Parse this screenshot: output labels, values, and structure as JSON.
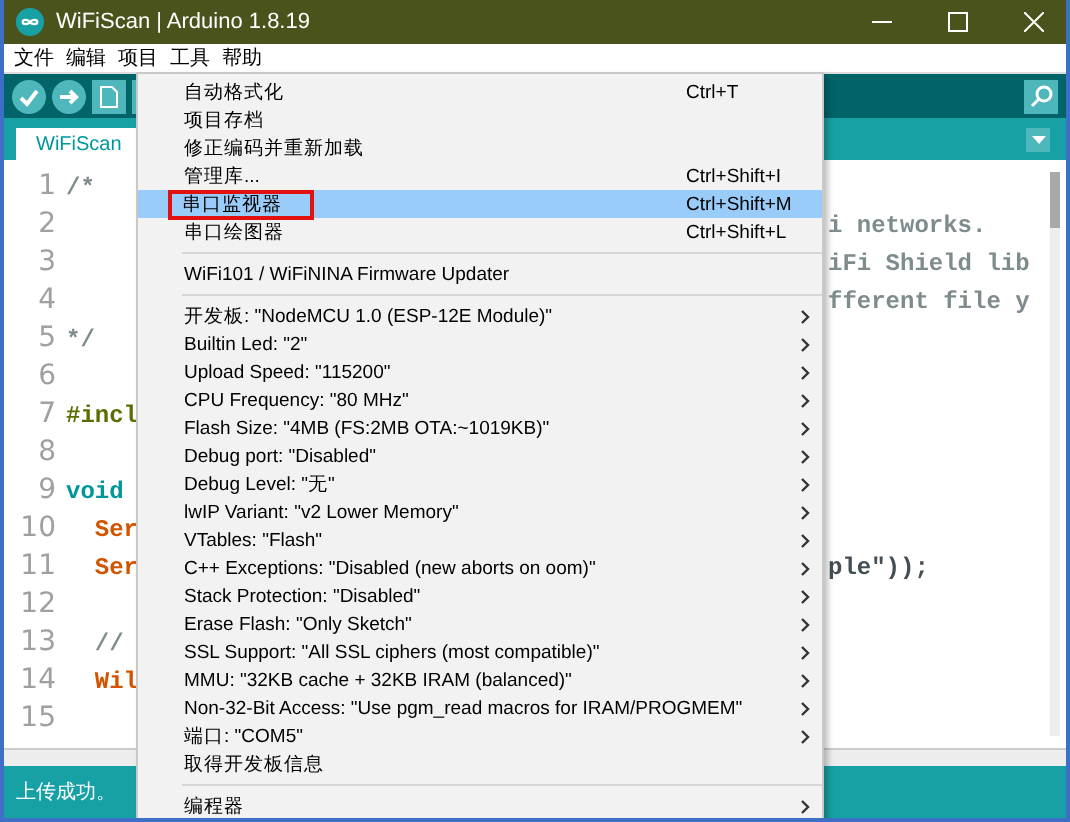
{
  "window": {
    "title": "WiFiScan | Arduino 1.8.19"
  },
  "menu_bar": [
    "文件",
    "编辑",
    "项目",
    "工具",
    "帮助"
  ],
  "tabs": [
    {
      "label": "WiFiScan",
      "selected": true
    }
  ],
  "editor": {
    "lines": [
      {
        "number": "1",
        "code": "/*",
        "kind": "comment"
      },
      {
        "number": "2",
        "tail": {
          "text": "i networks.",
          "kind": "comment"
        }
      },
      {
        "number": "3",
        "tail": {
          "text": "iFi Shield lib",
          "kind": "comment"
        }
      },
      {
        "number": "4",
        "tail": {
          "text": "fferent file y",
          "kind": "comment"
        }
      },
      {
        "number": "5",
        "code": "*/",
        "kind": "comment"
      },
      {
        "number": "6"
      },
      {
        "number": "7",
        "code": "#incl",
        "kind": "directive"
      },
      {
        "number": "8"
      },
      {
        "number": "9",
        "code": "void",
        "kind": "keyword"
      },
      {
        "number": "10",
        "code": "  Ser",
        "kind": "object"
      },
      {
        "number": "11",
        "code": "  Ser",
        "kind": "object",
        "tail": {
          "text": "ple\"));",
          "kind": "plain"
        }
      },
      {
        "number": "12"
      },
      {
        "number": "13",
        "code": "  //",
        "kind": "comment"
      },
      {
        "number": "14",
        "code": "  Wil",
        "kind": "object"
      },
      {
        "number": "15"
      }
    ]
  },
  "tools_menu": {
    "items": [
      {
        "kind": "item",
        "label": "自动格式化",
        "shortcut": "Ctrl+T",
        "selected": false,
        "outlined": false
      },
      {
        "kind": "item",
        "label": "项目存档",
        "selected": false,
        "outlined": false
      },
      {
        "kind": "item",
        "label": "修正编码并重新加载",
        "selected": false,
        "outlined": false
      },
      {
        "kind": "item",
        "label": "管理库...",
        "shortcut": "Ctrl+Shift+I",
        "selected": false,
        "outlined": false
      },
      {
        "kind": "item",
        "label": "串口监视器",
        "shortcut": "Ctrl+Shift+M",
        "selected": true,
        "outlined": true
      },
      {
        "kind": "item",
        "label": "串口绘图器",
        "shortcut": "Ctrl+Shift+L",
        "selected": false,
        "outlined": false
      },
      {
        "kind": "separator"
      },
      {
        "kind": "item",
        "label": "WiFi101 / WiFiNINA Firmware Updater",
        "selected": false,
        "outlined": false
      },
      {
        "kind": "separator"
      },
      {
        "kind": "submenu",
        "label": "开发板: \"NodeMCU 1.0 (ESP-12E Module)\"",
        "selected": false,
        "outlined": false
      },
      {
        "kind": "submenu",
        "label": "Builtin Led: \"2\"",
        "selected": false,
        "outlined": false
      },
      {
        "kind": "submenu",
        "label": "Upload Speed: \"115200\"",
        "selected": false,
        "outlined": false
      },
      {
        "kind": "submenu",
        "label": "CPU Frequency: \"80 MHz\"",
        "selected": false,
        "outlined": false
      },
      {
        "kind": "submenu",
        "label": "Flash Size: \"4MB (FS:2MB OTA:~1019KB)\"",
        "selected": false,
        "outlined": false
      },
      {
        "kind": "submenu",
        "label": "Debug port: \"Disabled\"",
        "selected": false,
        "outlined": false
      },
      {
        "kind": "submenu",
        "label": "Debug Level: \"无\"",
        "selected": false,
        "outlined": false
      },
      {
        "kind": "submenu",
        "label": "lwIP Variant: \"v2 Lower Memory\"",
        "selected": false,
        "outlined": false
      },
      {
        "kind": "submenu",
        "label": "VTables: \"Flash\"",
        "selected": false,
        "outlined": false
      },
      {
        "kind": "submenu",
        "label": "C++ Exceptions: \"Disabled (new aborts on oom)\"",
        "selected": false,
        "outlined": false
      },
      {
        "kind": "submenu",
        "label": "Stack Protection: \"Disabled\"",
        "selected": false,
        "outlined": false
      },
      {
        "kind": "submenu",
        "label": "Erase Flash: \"Only Sketch\"",
        "selected": false,
        "outlined": false
      },
      {
        "kind": "submenu",
        "label": "SSL Support: \"All SSL ciphers (most compatible)\"",
        "selected": false,
        "outlined": false
      },
      {
        "kind": "submenu",
        "label": "MMU: \"32KB cache + 32KB IRAM (balanced)\"",
        "selected": false,
        "outlined": false
      },
      {
        "kind": "submenu",
        "label": "Non-32-Bit Access: \"Use pgm_read macros for IRAM/PROGMEM\"",
        "selected": false,
        "outlined": false
      },
      {
        "kind": "submenu",
        "label": "端口: \"COM5\"",
        "selected": false,
        "outlined": false
      },
      {
        "kind": "item",
        "label": "取得开发板信息",
        "selected": false,
        "outlined": false
      },
      {
        "kind": "separator"
      },
      {
        "kind": "submenu",
        "label": "编程器",
        "selected": false,
        "outlined": false
      }
    ]
  },
  "status_bar": {
    "message": "上传成功。"
  }
}
